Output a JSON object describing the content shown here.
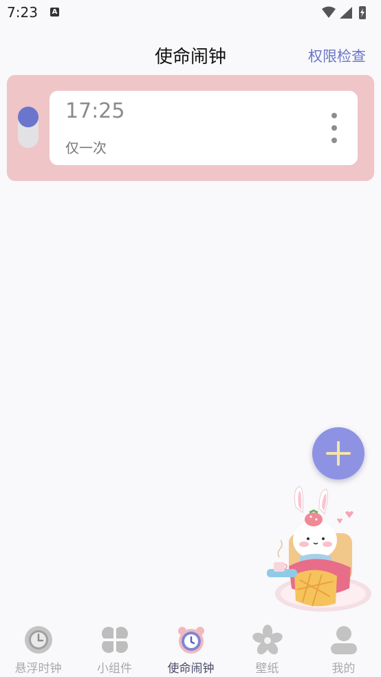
{
  "status_bar": {
    "time": "7:23",
    "notification_icon": "A"
  },
  "header": {
    "title": "使命闹钟",
    "action_label": "权限检查"
  },
  "alarm": {
    "time": "17:25",
    "repeat": "仅一次",
    "enabled": true
  },
  "fab": {
    "icon": "plus-icon"
  },
  "bottom_nav": {
    "items": [
      {
        "label": "悬浮时钟",
        "icon": "floating-clock-icon"
      },
      {
        "label": "小组件",
        "icon": "widget-clover-icon"
      },
      {
        "label": "使命闹钟",
        "icon": "alarm-clock-icon",
        "active": true
      },
      {
        "label": "壁纸",
        "icon": "flower-icon"
      },
      {
        "label": "我的",
        "icon": "profile-icon"
      }
    ]
  },
  "colors": {
    "accent": "#6b75cc",
    "card_bg": "#efc5c8",
    "fab": "#8d93e2",
    "header_action": "#6a76c8"
  }
}
